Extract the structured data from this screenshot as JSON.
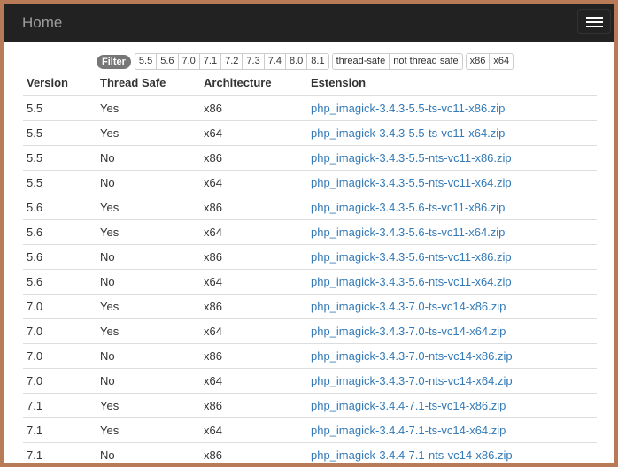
{
  "navbar": {
    "brand": "Home",
    "toggle_icon": "hamburger-icon"
  },
  "filters": {
    "label": "Filter",
    "versions": [
      "5.5",
      "5.6",
      "7.0",
      "7.1",
      "7.2",
      "7.3",
      "7.4",
      "8.0",
      "8.1"
    ],
    "thread": [
      "thread-safe",
      "not thread safe"
    ],
    "arch": [
      "x86",
      "x64"
    ]
  },
  "table": {
    "headers": [
      "Version",
      "Thread Safe",
      "Architecture",
      "Estension"
    ],
    "rows": [
      [
        "5.5",
        "Yes",
        "x86",
        "php_imagick-3.4.3-5.5-ts-vc11-x86.zip"
      ],
      [
        "5.5",
        "Yes",
        "x64",
        "php_imagick-3.4.3-5.5-ts-vc11-x64.zip"
      ],
      [
        "5.5",
        "No",
        "x86",
        "php_imagick-3.4.3-5.5-nts-vc11-x86.zip"
      ],
      [
        "5.5",
        "No",
        "x64",
        "php_imagick-3.4.3-5.5-nts-vc11-x64.zip"
      ],
      [
        "5.6",
        "Yes",
        "x86",
        "php_imagick-3.4.3-5.6-ts-vc11-x86.zip"
      ],
      [
        "5.6",
        "Yes",
        "x64",
        "php_imagick-3.4.3-5.6-ts-vc11-x64.zip"
      ],
      [
        "5.6",
        "No",
        "x86",
        "php_imagick-3.4.3-5.6-nts-vc11-x86.zip"
      ],
      [
        "5.6",
        "No",
        "x64",
        "php_imagick-3.4.3-5.6-nts-vc11-x64.zip"
      ],
      [
        "7.0",
        "Yes",
        "x86",
        "php_imagick-3.4.3-7.0-ts-vc14-x86.zip"
      ],
      [
        "7.0",
        "Yes",
        "x64",
        "php_imagick-3.4.3-7.0-ts-vc14-x64.zip"
      ],
      [
        "7.0",
        "No",
        "x86",
        "php_imagick-3.4.3-7.0-nts-vc14-x86.zip"
      ],
      [
        "7.0",
        "No",
        "x64",
        "php_imagick-3.4.3-7.0-nts-vc14-x64.zip"
      ],
      [
        "7.1",
        "Yes",
        "x86",
        "php_imagick-3.4.4-7.1-ts-vc14-x86.zip"
      ],
      [
        "7.1",
        "Yes",
        "x64",
        "php_imagick-3.4.4-7.1-ts-vc14-x64.zip"
      ],
      [
        "7.1",
        "No",
        "x86",
        "php_imagick-3.4.4-7.1-nts-vc14-x86.zip"
      ]
    ]
  }
}
